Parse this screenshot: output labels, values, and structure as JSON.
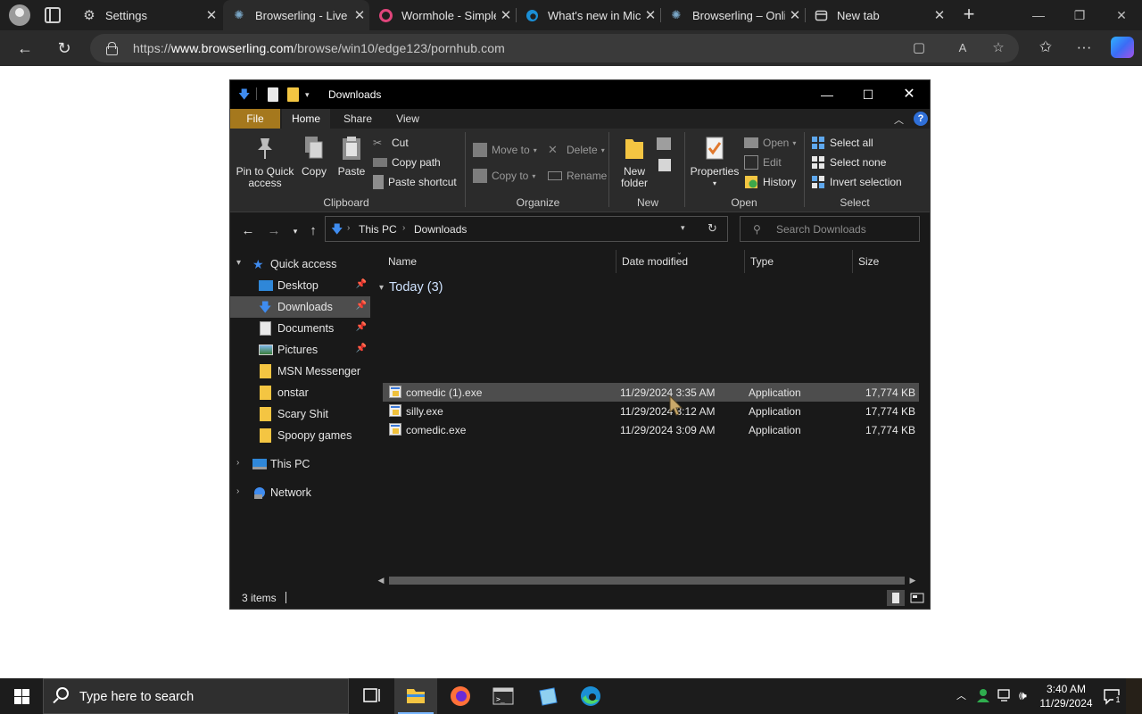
{
  "browser": {
    "tabs": [
      {
        "title": "Settings",
        "icon": "gear-icon",
        "active": false
      },
      {
        "title": "Browserling - Live ",
        "icon": "browserling-icon",
        "active": true
      },
      {
        "title": "Wormhole - Simple",
        "icon": "wormhole-icon",
        "active": false
      },
      {
        "title": "What's new in Micr",
        "icon": "edge-icon",
        "active": false
      },
      {
        "title": "Browserling – Onli",
        "icon": "browserling-icon",
        "active": false
      },
      {
        "title": "New tab",
        "icon": "newtab-icon",
        "active": false
      }
    ],
    "url_prefix": "https://",
    "url_host": "www.browserling.com",
    "url_path": "/browse/win10/edge123/pornhub.com"
  },
  "explorer": {
    "title": "Downloads",
    "ribbon_tabs": [
      "File",
      "Home",
      "Share",
      "View"
    ],
    "clipboard": {
      "pin_label": "Pin to Quick access",
      "copy": "Copy",
      "paste": "Paste",
      "cut": "Cut",
      "copy_path": "Copy path",
      "paste_shortcut": "Paste shortcut",
      "group": "Clipboard"
    },
    "organize": {
      "move_to": "Move to",
      "copy_to": "Copy to",
      "delete": "Delete",
      "rename": "Rename",
      "group": "Organize"
    },
    "new": {
      "new_folder": "New folder",
      "group": "New"
    },
    "open": {
      "properties": "Properties",
      "open": "Open",
      "edit": "Edit",
      "history": "History",
      "group": "Open"
    },
    "select": {
      "select_all": "Select all",
      "select_none": "Select none",
      "invert": "Invert selection",
      "group": "Select"
    },
    "path": [
      "This PC",
      "Downloads"
    ],
    "search_placeholder": "Search Downloads",
    "nav": [
      {
        "label": "Quick access",
        "type": "root",
        "expanded": true
      },
      {
        "label": "Desktop",
        "type": "pinned"
      },
      {
        "label": "Downloads",
        "type": "pinned",
        "selected": true
      },
      {
        "label": "Documents",
        "type": "pinned"
      },
      {
        "label": "Pictures",
        "type": "pinned"
      },
      {
        "label": "MSN Messenger",
        "type": "folder"
      },
      {
        "label": "onstar",
        "type": "folder"
      },
      {
        "label": "Scary Shit",
        "type": "folder"
      },
      {
        "label": "Spoopy games",
        "type": "folder"
      },
      {
        "label": "This PC",
        "type": "root"
      },
      {
        "label": "Network",
        "type": "root"
      }
    ],
    "columns": [
      "Name",
      "Date modified",
      "Type",
      "Size"
    ],
    "group_header": "Today (3)",
    "files": [
      {
        "name": "comedic (1).exe",
        "date": "11/29/2024 3:35 AM",
        "type": "Application",
        "size": "17,774 KB",
        "hover": true
      },
      {
        "name": "silly.exe",
        "date": "11/29/2024 3:12 AM",
        "type": "Application",
        "size": "17,774 KB",
        "hover": false
      },
      {
        "name": "comedic.exe",
        "date": "11/29/2024 3:09 AM",
        "type": "Application",
        "size": "17,774 KB",
        "hover": false
      }
    ],
    "status": "3 items"
  },
  "taskbar": {
    "search_placeholder": "Type here to search",
    "time": "3:40 AM",
    "date": "11/29/2024",
    "notification_count": "1"
  }
}
